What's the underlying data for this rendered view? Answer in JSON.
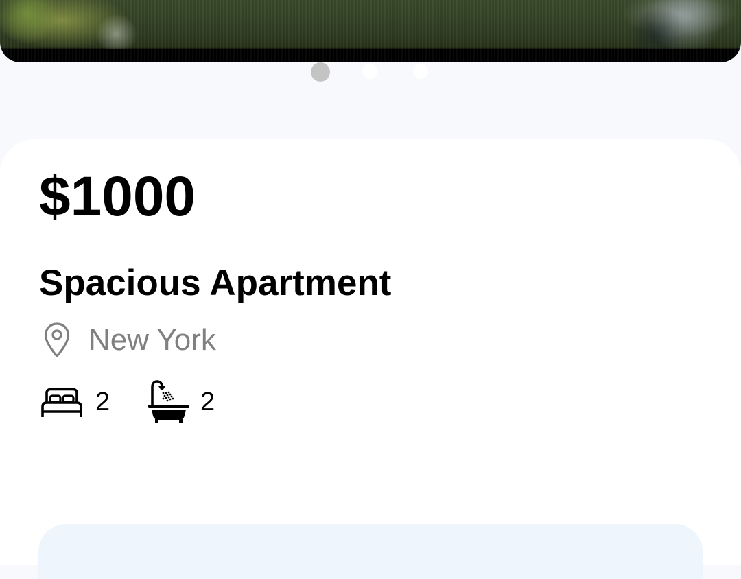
{
  "listing": {
    "price": "$1000",
    "title": "Spacious Apartment",
    "location": "New York",
    "bedrooms": "2",
    "bathrooms": "2"
  },
  "carousel": {
    "page_count": 3,
    "active_index": 0
  },
  "icons": {
    "location": "map-pin-icon",
    "bedrooms": "bed-icon",
    "bathrooms": "bathtub-icon"
  },
  "colors": {
    "background": "#f7f9fd",
    "card": "#ffffff",
    "active_dot": "#c4c4c4",
    "inactive_dot": "#ffffff",
    "secondary_text": "#808080",
    "bottom_panel": "#eef5fc"
  }
}
